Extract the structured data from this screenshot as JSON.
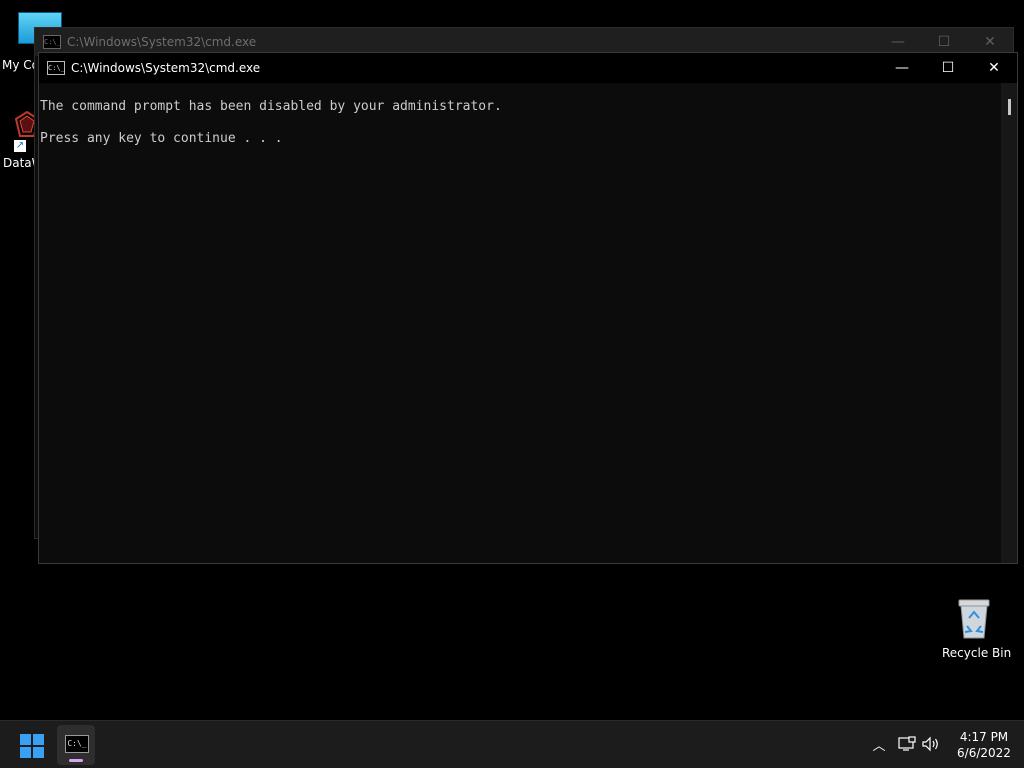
{
  "desktop": {
    "icons": [
      {
        "label": "My Co"
      },
      {
        "label": "DataW"
      },
      {
        "label": "Recycle Bin"
      }
    ]
  },
  "windows": [
    {
      "title": "C:\\Windows\\System32\\cmd.exe",
      "state": "inactive",
      "icon_text": "C:\\_"
    },
    {
      "title": "C:\\Windows\\System32\\cmd.exe",
      "state": "active",
      "icon_text": "C:\\_",
      "console_lines": [
        "The command prompt has been disabled by your administrator.",
        "",
        "Press any key to continue . . ."
      ]
    }
  ],
  "window_controls": {
    "minimize": "—",
    "maximize": "☐",
    "close": "✕"
  },
  "taskbar": {
    "cmd_icon_text": "C:\\_",
    "tray_chevron": "︿",
    "clock": {
      "time": "4:17 PM",
      "date": "6/6/2022"
    }
  },
  "colors": {
    "console_bg": "#0c0c0c",
    "console_text": "#cccccc",
    "taskbar_bg": "#1c1c1c",
    "start_blue": "#3aa0f3",
    "running_indicator": "#d9a3f0"
  },
  "icons": [
    "computer-icon",
    "datawatch-icon",
    "shortcut-arrow-icon",
    "recycle-bin-icon",
    "cmd-icon",
    "windows-start-icon",
    "chevron-up-icon",
    "network-icon",
    "volume-icon"
  ]
}
